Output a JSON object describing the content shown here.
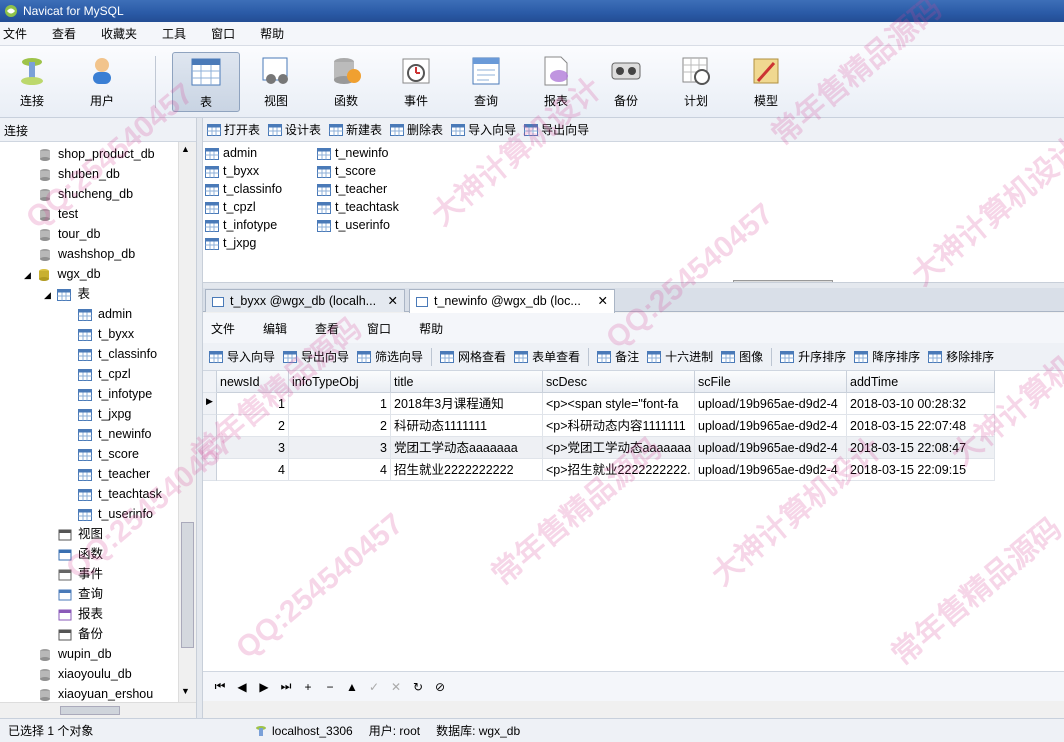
{
  "window": {
    "title": "Navicat for MySQL"
  },
  "menu": [
    "文件",
    "查看",
    "收藏夹",
    "工具",
    "窗口",
    "帮助"
  ],
  "toolbar": [
    {
      "label": "连接",
      "icon": "connection-icon"
    },
    {
      "label": "用户",
      "icon": "user-icon"
    },
    {
      "label": "表",
      "icon": "table-icon",
      "active": true
    },
    {
      "label": "视图",
      "icon": "view-icon"
    },
    {
      "label": "函数",
      "icon": "function-icon"
    },
    {
      "label": "事件",
      "icon": "event-icon"
    },
    {
      "label": "查询",
      "icon": "query-icon"
    },
    {
      "label": "报表",
      "icon": "report-icon"
    },
    {
      "label": "备份",
      "icon": "backup-icon"
    },
    {
      "label": "计划",
      "icon": "schedule-icon"
    },
    {
      "label": "模型",
      "icon": "model-icon"
    }
  ],
  "sidebar": {
    "header": "连接",
    "databases_before": [
      "shop_product_db",
      "shuben_db",
      "shucheng_db",
      "test",
      "tour_db",
      "washshop_db"
    ],
    "open_db": "wgx_db",
    "tables_node": "表",
    "tables": [
      "admin",
      "t_byxx",
      "t_classinfo",
      "t_cpzl",
      "t_infotype",
      "t_jxpg",
      "t_newinfo",
      "t_score",
      "t_teacher",
      "t_teachtask",
      "t_userinfo"
    ],
    "other_nodes": [
      {
        "label": "视图",
        "icon": "view-icon"
      },
      {
        "label": "函数",
        "icon": "function-icon"
      },
      {
        "label": "事件",
        "icon": "event-icon"
      },
      {
        "label": "查询",
        "icon": "query-icon"
      },
      {
        "label": "报表",
        "icon": "report-icon"
      },
      {
        "label": "备份",
        "icon": "backup-icon"
      }
    ],
    "databases_after": [
      "wupin_db",
      "xiaoyoulu_db",
      "xiaoyuan_ershou"
    ]
  },
  "object_toolbar": [
    "打开表",
    "设计表",
    "新建表",
    "删除表",
    "导入向导",
    "导出向导"
  ],
  "object_list": [
    "admin",
    "t_byxx",
    "t_classinfo",
    "t_cpzl",
    "t_infotype",
    "t_jxpg",
    "t_newinfo",
    "t_score",
    "t_teacher",
    "t_teachtask",
    "t_userinfo"
  ],
  "tabs": [
    {
      "label": "t_byxx @wgx_db (localh...",
      "close": "✕"
    },
    {
      "label": "t_newinfo @wgx_db (loc...",
      "close": "✕",
      "active": true
    }
  ],
  "inner_menu": [
    "文件",
    "编辑",
    "查看",
    "窗口",
    "帮助"
  ],
  "inner_toolbar": [
    "导入向导",
    "导出向导",
    "筛选向导",
    "网格查看",
    "表单查看",
    "备注",
    "十六进制",
    "图像",
    "升序排序",
    "降序排序",
    "移除排序"
  ],
  "grid": {
    "columns": [
      "newsId",
      "infoTypeObj",
      "title",
      "scDesc",
      "scFile",
      "addTime"
    ],
    "rows": [
      [
        "1",
        "1",
        "2018年3月课程通知",
        "<p><span style=\"font-fa",
        "upload/19b965ae-d9d2-4",
        "2018-03-10 00:28:32"
      ],
      [
        "2",
        "2",
        "科研动态1111111",
        "<p>科研动态内容1111111",
        "upload/19b965ae-d9d2-4",
        "2018-03-15 22:07:48"
      ],
      [
        "3",
        "3",
        "党团工学动态aaaaaaa",
        "<p>党团工学动态aaaaaaa",
        "upload/19b965ae-d9d2-4",
        "2018-03-15 22:08:47"
      ],
      [
        "4",
        "4",
        "招生就业2222222222",
        "<p>招生就业2222222222.",
        "upload/19b965ae-d9d2-4",
        "2018-03-15 22:09:15"
      ]
    ]
  },
  "navbar": [
    "⏮",
    "◀",
    "▶",
    "⏭",
    "+",
    "−",
    "▲",
    "✓",
    "✕",
    "↻",
    "⊘"
  ],
  "status": {
    "selection": "已选择 1 个对象",
    "host": "localhost_3306",
    "user": "用户: root",
    "database": "数据库: wgx_db"
  },
  "watermarks": [
    "QQ:254540457",
    "常年售精品源码",
    "大神计算机设计",
    "QQ:254540457",
    "常年售精品源码",
    "大神计算机设计",
    "QQ:254540457",
    "常年售精品源码",
    "大神计算机设计",
    "QQ:254540457",
    "常年售精品源码",
    "大神计算机设计"
  ]
}
